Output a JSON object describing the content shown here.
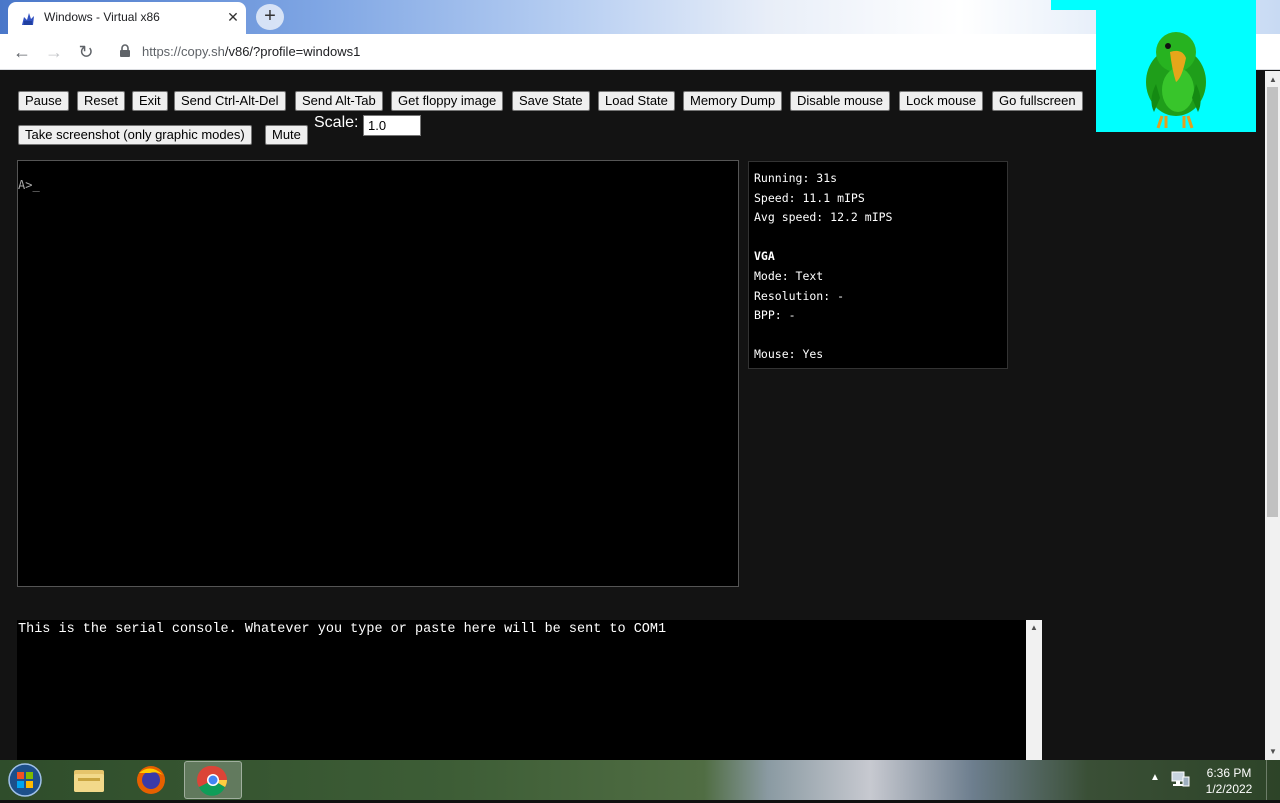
{
  "tab": {
    "title": "Windows - Virtual x86",
    "close": "✕",
    "new_tab": "+"
  },
  "toolbar": {
    "back": "←",
    "forward": "→",
    "reload": "↻",
    "url_host": "https://copy.sh",
    "url_path": "/v86/?profile=windows1"
  },
  "controls": {
    "buttons_row1": [
      "Pause",
      "Reset",
      "Exit",
      "Send Ctrl-Alt-Del",
      "Send Alt-Tab",
      "Get floppy image",
      "Save State",
      "Load State",
      "Memory Dump",
      "Disable mouse",
      "Lock mouse",
      "Go fullscreen"
    ],
    "screenshot_label": "Take screenshot (only graphic modes)",
    "mute_label": "Mute",
    "scale_label": "Scale:",
    "scale_value": "1.0"
  },
  "screen": {
    "text": "A>_"
  },
  "info": {
    "running": "Running: 31s",
    "speed": "Speed: 11.1 mIPS",
    "avg_speed": "Avg speed: 12.2 mIPS",
    "vga_heading": "VGA",
    "mode": "Mode: Text",
    "resolution": "Resolution: -",
    "bpp": "BPP: -",
    "mouse": "Mouse: Yes"
  },
  "serial": {
    "text": "This is the serial console. Whatever you type or paste here will be sent to COM1"
  },
  "taskbar": {
    "time": "6:36 PM",
    "date": "1/2/2022",
    "tray_arrow": "▲"
  },
  "colors": {
    "page_bg": "#131313",
    "overlay_cyan": "#00ffff",
    "terminal_bg": "#000000"
  }
}
